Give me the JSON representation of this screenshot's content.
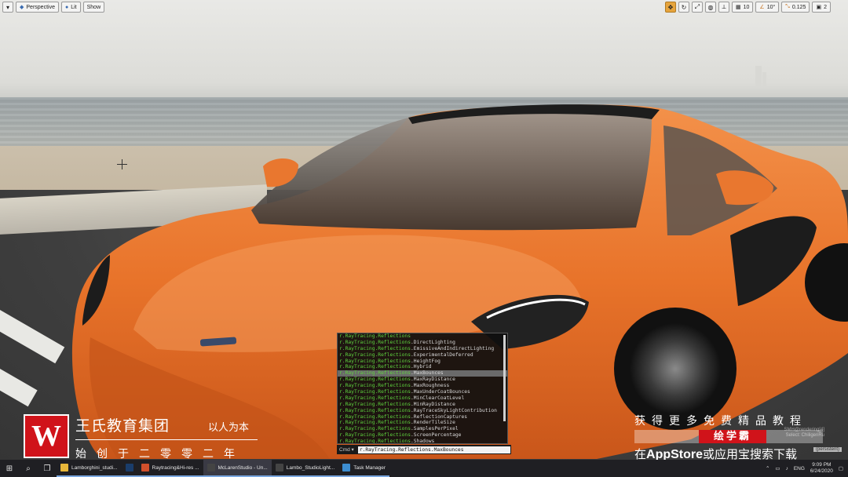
{
  "toolbar": {
    "menu_label": "▾",
    "perspective_label": "Perspective",
    "lit_label": "Lit",
    "show_label": "Show",
    "right": {
      "grid_value": "10",
      "angle_value": "10°",
      "scale_value": "0.125",
      "camera_speed": "2"
    }
  },
  "console": {
    "suggestions": [
      {
        "prefix": "r.RayTracing.Reflections",
        "suffix": ""
      },
      {
        "prefix": "r.RayTracing.Reflections",
        "suffix": ".DirectLighting"
      },
      {
        "prefix": "r.RayTracing.Reflections",
        "suffix": ".EmissiveAndIndirectLighting"
      },
      {
        "prefix": "r.RayTracing.Reflections",
        "suffix": ".ExperimentalDeferred"
      },
      {
        "prefix": "r.RayTracing.Reflections",
        "suffix": ".HeightFog"
      },
      {
        "prefix": "r.RayTracing.Reflections",
        "suffix": ".Hybrid"
      },
      {
        "prefix": "r.RayTracing.Reflections",
        "suffix": ".MaxBounces"
      },
      {
        "prefix": "r.RayTracing.Reflections",
        "suffix": ".MaxRayDistance"
      },
      {
        "prefix": "r.RayTracing.Reflections",
        "suffix": ".MaxRoughness"
      },
      {
        "prefix": "r.RayTracing.Reflections",
        "suffix": ".MaxUnderCoatBounces"
      },
      {
        "prefix": "r.RayTracing.Reflections",
        "suffix": ".MinClearCoatLevel"
      },
      {
        "prefix": "r.RayTracing.Reflections",
        "suffix": ".MinRayDistance"
      },
      {
        "prefix": "r.RayTracing.Reflections",
        "suffix": ".RayTraceSkyLightContribution"
      },
      {
        "prefix": "r.RayTracing.Reflections",
        "suffix": ".ReflectionCaptures"
      },
      {
        "prefix": "r.RayTracing.Reflections",
        "suffix": ".RenderTileSize"
      },
      {
        "prefix": "r.RayTracing.Reflections",
        "suffix": ".SamplesPerPixel"
      },
      {
        "prefix": "r.RayTracing.Reflections",
        "suffix": ".ScreenPercentage"
      },
      {
        "prefix": "r.RayTracing.Reflections",
        "suffix": ".Shadows"
      }
    ],
    "selected_index": 6,
    "cmd_label": "Cmd ▾",
    "input_value": "r.RayTracing.Reflections.MaxBounces"
  },
  "watermark": {
    "logo_letter": "W",
    "company": "王氏教育集团",
    "slogan": "以人为本",
    "founded": "始创于二零零二年"
  },
  "promo": {
    "top": "获得更多免费精品教程",
    "highlight": "绘学霸",
    "bottom_1": "在",
    "bottom_appstore": "AppStore",
    "bottom_2": "或应用宝搜索下载"
  },
  "overlay_status": {
    "line1": "SMH@rendering[4]",
    "line2": "Select: ChiligenRu",
    "persist": "(persistent)"
  },
  "taskbar": {
    "items": [
      {
        "label": "Lamborghini_studi...",
        "color": "#e8b73a",
        "active": false
      },
      {
        "label": "",
        "color": "#1a3d6b",
        "active": false
      },
      {
        "label": "Raytracing&Hi-res ...",
        "color": "#d2502c",
        "active": false
      },
      {
        "label": "McLarenStudio - Un...",
        "color": "#444",
        "active": true
      },
      {
        "label": "Lambo_StudioLight...",
        "color": "#444",
        "active": false
      },
      {
        "label": "Task Manager",
        "color": "#3c8dd0",
        "active": false
      }
    ],
    "lang": "ENG",
    "time": "9:09 PM",
    "date": "6/24/2020"
  }
}
